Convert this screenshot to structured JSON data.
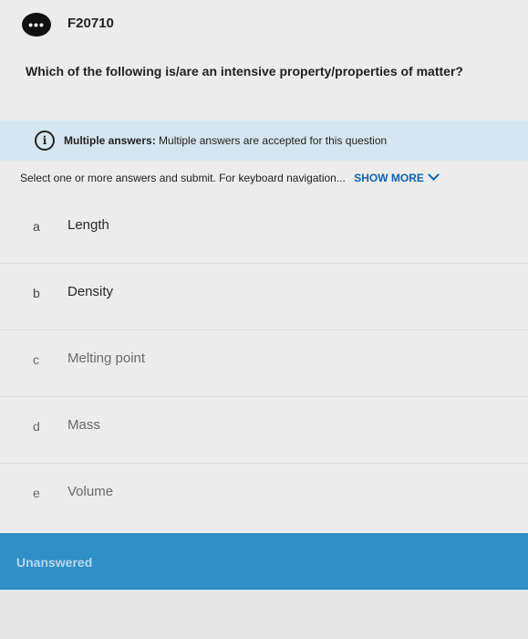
{
  "header": {
    "menu_glyph": "•••",
    "question_id": "F20710"
  },
  "question": {
    "text": "Which of the following is/are an intensive property/properties of matter?"
  },
  "info": {
    "title": "Multiple answers:",
    "message": "Multiple answers are accepted for this question"
  },
  "instructions": {
    "text": "Select one or more answers and submit. For keyboard navigation...",
    "show_more": "SHOW MORE"
  },
  "options": [
    {
      "letter": "a",
      "label": "Length"
    },
    {
      "letter": "b",
      "label": "Density"
    },
    {
      "letter": "c",
      "label": "Melting point"
    },
    {
      "letter": "d",
      "label": "Mass"
    },
    {
      "letter": "e",
      "label": "Volume"
    }
  ],
  "status": {
    "text": "Unanswered",
    "color": "#2f8fc6"
  }
}
